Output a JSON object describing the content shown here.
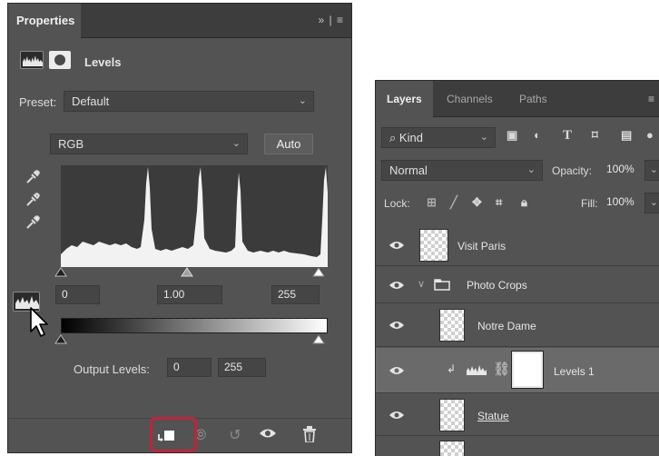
{
  "properties": {
    "tab_title": "Properties",
    "menu_glyph": "»  |  ≡",
    "adjustment_title": "Levels",
    "preset_label": "Preset:",
    "preset_value": "Default",
    "channel_value": "RGB",
    "auto_label": "Auto",
    "input_black": "0",
    "input_gamma": "1.00",
    "input_white": "255",
    "output_label": "Output Levels:",
    "output_black": "0",
    "output_white": "255",
    "clip_highlight_color": "#c2233a"
  },
  "layers": {
    "tabs": [
      "Layers",
      "Channels",
      "Paths"
    ],
    "filter_kind": "Kind",
    "blend_mode": "Normal",
    "opacity_label": "Opacity:",
    "opacity_value": "100%",
    "lock_label": "Lock:",
    "fill_label": "Fill:",
    "fill_value": "100%",
    "rows": [
      {
        "name": "Visit Paris"
      },
      {
        "name": "Photo Crops"
      },
      {
        "name": "Notre Dame"
      },
      {
        "name": "Levels 1"
      },
      {
        "name": "Statue"
      }
    ]
  }
}
